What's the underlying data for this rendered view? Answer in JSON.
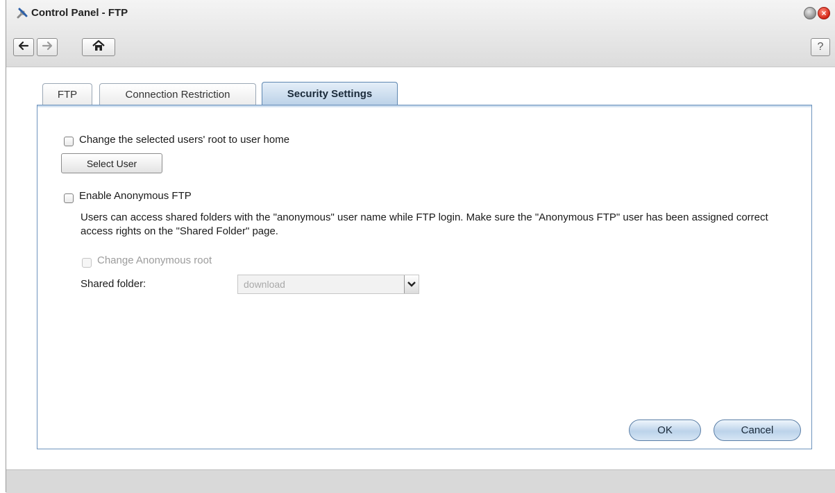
{
  "window": {
    "title": "Control Panel - FTP"
  },
  "toolbar": {
    "help_label": "?"
  },
  "tabs": [
    {
      "label": "FTP",
      "active": false
    },
    {
      "label": "Connection Restriction",
      "active": false
    },
    {
      "label": "Security Settings",
      "active": true
    }
  ],
  "security": {
    "change_root_label": "Change the selected users' root to user home",
    "change_root_checked": false,
    "select_user_label": "Select User",
    "anon_label": "Enable Anonymous FTP",
    "anon_checked": false,
    "anon_description": "Users can access shared folders with the \"anonymous\" user name while FTP login. Make sure the \"Anonymous FTP\" user has been assigned correct access rights on the \"Shared Folder\" page.",
    "anon_root_label": "Change Anonymous root",
    "anon_root_checked": false,
    "shared_folder_label": "Shared folder:",
    "shared_folder_value": "download"
  },
  "actions": {
    "ok_label": "OK",
    "cancel_label": "Cancel"
  },
  "colors": {
    "accent": "#bcd2e8",
    "active_tab_border": "#5d86b0",
    "close_button": "#d21f0f"
  }
}
